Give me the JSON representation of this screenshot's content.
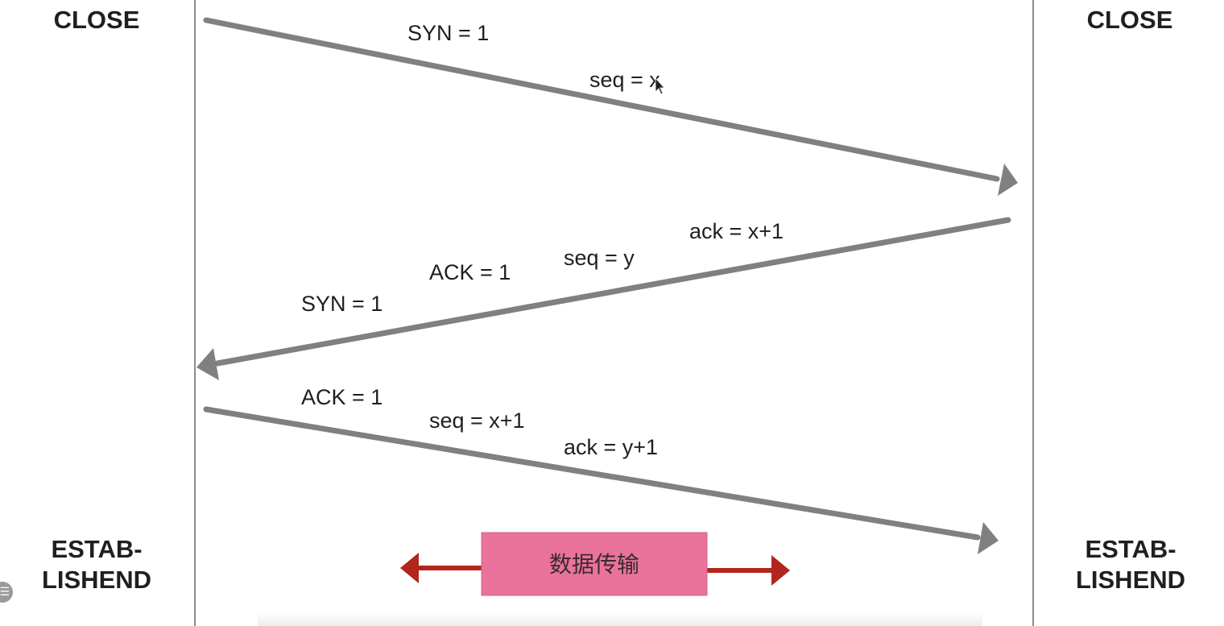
{
  "client": {
    "top_state": "CLOSE",
    "bottom_state_line1": "ESTAB-",
    "bottom_state_line2": "LISHEND"
  },
  "server": {
    "top_state": "CLOSE",
    "bottom_state_line1": "ESTAB-",
    "bottom_state_line2": "LISHEND"
  },
  "messages": [
    {
      "labels": [
        "SYN = 1",
        "seq = x"
      ]
    },
    {
      "labels": [
        "ack = x+1",
        "seq = y",
        "ACK = 1",
        "SYN = 1"
      ]
    },
    {
      "labels": [
        "ACK = 1",
        "seq = x+1",
        "ack = y+1"
      ]
    }
  ],
  "data_transfer": {
    "label": "数据传输"
  },
  "colors": {
    "arrow": "#808080",
    "lifeline": "#8c8c8c",
    "data_box": "#e9739b",
    "data_arrow": "#b3261e"
  }
}
